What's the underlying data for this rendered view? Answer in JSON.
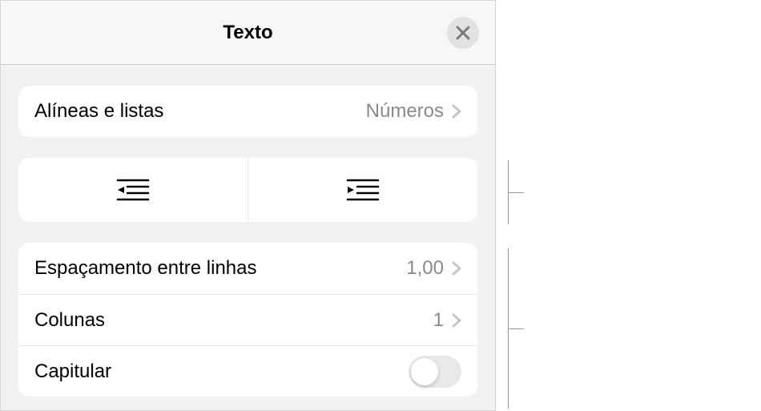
{
  "header": {
    "title": "Texto"
  },
  "bullets": {
    "label": "Alíneas e listas",
    "value": "Números"
  },
  "spacing": {
    "label": "Espaçamento entre linhas",
    "value": "1,00"
  },
  "columns": {
    "label": "Colunas",
    "value": "1"
  },
  "dropcap": {
    "label": "Capitular"
  }
}
